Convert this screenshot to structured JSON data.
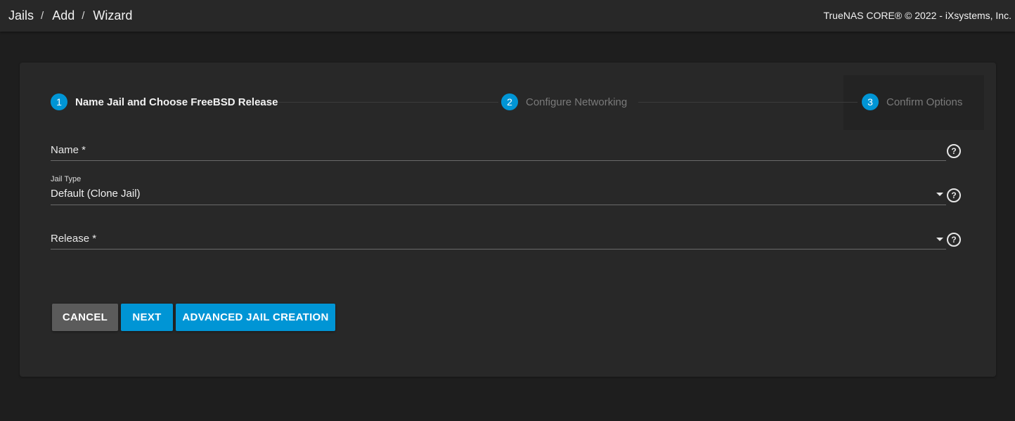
{
  "breadcrumb": [
    "Jails",
    "Add",
    "Wizard"
  ],
  "copyright": "TrueNAS CORE® © 2022 - iXsystems, Inc.",
  "steps": [
    {
      "number": "1",
      "label": "Name Jail and Choose FreeBSD Release",
      "state": "active"
    },
    {
      "number": "2",
      "label": "Configure Networking",
      "state": "inactive"
    },
    {
      "number": "3",
      "label": "Confirm Options",
      "state": "inactive"
    }
  ],
  "form": {
    "name": {
      "label": "Name *",
      "value": "",
      "help_icon": "help-circle-icon"
    },
    "jail_type": {
      "label": "Jail Type",
      "value": "Default (Clone Jail)",
      "help_icon": "help-circle-icon"
    },
    "release": {
      "label": "Release *",
      "value": "",
      "help_icon": "help-circle-icon"
    }
  },
  "buttons": {
    "cancel": "CANCEL",
    "next": "NEXT",
    "advanced": "ADVANCED JAIL CREATION"
  },
  "help_glyph": "?",
  "colors": {
    "accent": "#0095d5",
    "background": "#1e1e1e",
    "card": "#282828",
    "cancel": "#5b5b5b"
  }
}
